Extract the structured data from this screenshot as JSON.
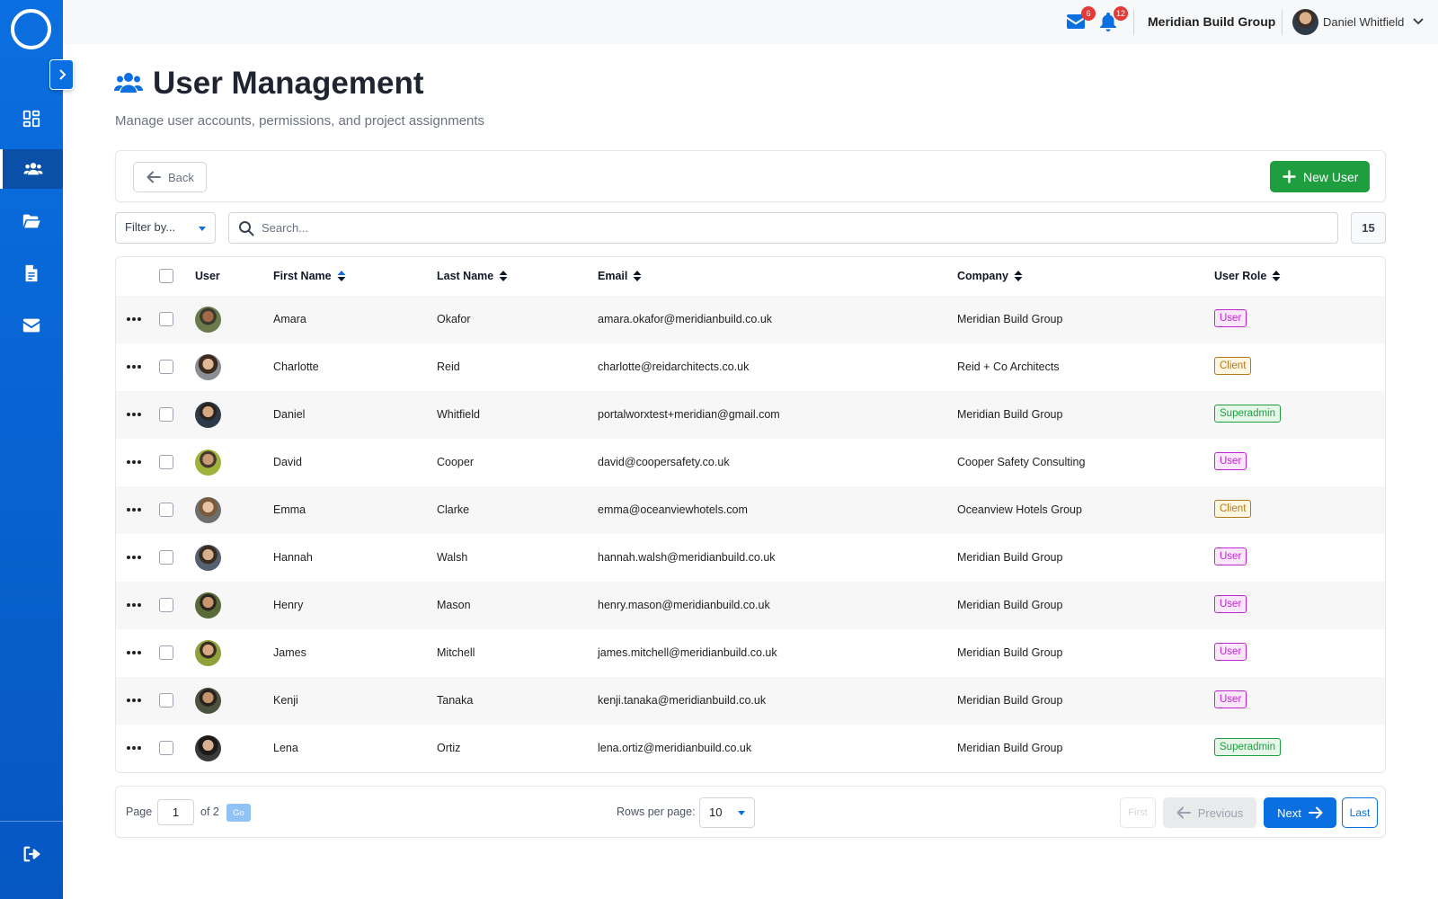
{
  "app": {
    "colors": {
      "primary": "#0a6fe0",
      "success": "#1e9e3e"
    }
  },
  "sidebar": {
    "items": [
      {
        "icon": "dashboard-icon",
        "active": false
      },
      {
        "icon": "users-icon",
        "active": true
      },
      {
        "icon": "folder-open-icon",
        "active": false
      },
      {
        "icon": "document-icon",
        "active": false
      },
      {
        "icon": "envelope-icon",
        "active": false
      }
    ],
    "logout_icon": "logout-icon"
  },
  "topbar": {
    "mail_count": "6",
    "notification_count": "12",
    "company": "Meridian Build Group",
    "user_name": "Daniel Whitfield"
  },
  "header": {
    "title": "User Management",
    "subtitle": "Manage user accounts, permissions, and project assignments"
  },
  "actions": {
    "back_label": "Back",
    "new_user_label": "New User"
  },
  "filters": {
    "filter_label": "Filter by...",
    "search_placeholder": "Search...",
    "count": "15"
  },
  "table": {
    "columns": [
      "User",
      "First Name",
      "Last Name",
      "Email",
      "Company",
      "User Role"
    ],
    "rows": [
      {
        "first": "Amara",
        "last": "Okafor",
        "email": "amara.okafor@meridianbuild.co.uk",
        "company": "Meridian Build Group",
        "role": "User"
      },
      {
        "first": "Charlotte",
        "last": "Reid",
        "email": "charlotte@reidarchitects.co.uk",
        "company": "Reid + Co Architects",
        "role": "Client"
      },
      {
        "first": "Daniel",
        "last": "Whitfield",
        "email": "portalworxtest+meridian@gmail.com",
        "company": "Meridian Build Group",
        "role": "Superadmin"
      },
      {
        "first": "David",
        "last": "Cooper",
        "email": "david@coopersafety.co.uk",
        "company": "Cooper Safety Consulting",
        "role": "User"
      },
      {
        "first": "Emma",
        "last": "Clarke",
        "email": "emma@oceanviewhotels.com",
        "company": "Oceanview Hotels Group",
        "role": "Client"
      },
      {
        "first": "Hannah",
        "last": "Walsh",
        "email": "hannah.walsh@meridianbuild.co.uk",
        "company": "Meridian Build Group",
        "role": "User"
      },
      {
        "first": "Henry",
        "last": "Mason",
        "email": "henry.mason@meridianbuild.co.uk",
        "company": "Meridian Build Group",
        "role": "User"
      },
      {
        "first": "James",
        "last": "Mitchell",
        "email": "james.mitchell@meridianbuild.co.uk",
        "company": "Meridian Build Group",
        "role": "User"
      },
      {
        "first": "Kenji",
        "last": "Tanaka",
        "email": "kenji.tanaka@meridianbuild.co.uk",
        "company": "Meridian Build Group",
        "role": "User"
      },
      {
        "first": "Lena",
        "last": "Ortiz",
        "email": "lena.ortiz@meridianbuild.co.uk",
        "company": "Meridian Build Group",
        "role": "Superadmin"
      }
    ]
  },
  "pagination": {
    "page_label": "Page",
    "page_value": "1",
    "of_label": "of 2",
    "go_label": "Go",
    "rows_label": "Rows per page:",
    "rows_value": "10",
    "first_label": "First",
    "prev_label": "Previous",
    "next_label": "Next",
    "last_label": "Last"
  }
}
